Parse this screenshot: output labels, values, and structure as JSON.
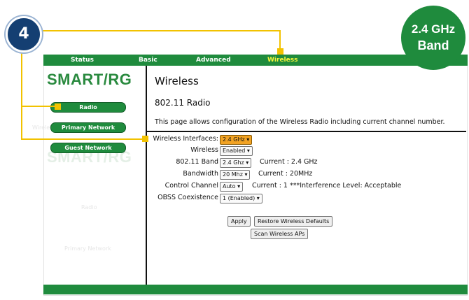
{
  "callout": {
    "step_number": "4",
    "badge_line1": "2.4 GHz",
    "badge_line2": "Band"
  },
  "nav": {
    "items": [
      "Status",
      "Basic",
      "Advanced",
      "Wireless"
    ],
    "active_index": 3
  },
  "brand": {
    "logo_text": "SMART/RG",
    "accent_color": "#1f8b3d",
    "highlight_color": "#f2c200"
  },
  "sidebar": {
    "items": [
      "Radio",
      "Primary Network",
      "Guest Network"
    ]
  },
  "page": {
    "title": "Wireless",
    "section_title": "802.11 Radio",
    "description": "This page allows configuration of the Wireless Radio including current channel number."
  },
  "form": {
    "interfaces": {
      "label": "Wireless Interfaces:",
      "value": "2.4 GHz"
    },
    "wireless": {
      "label": "Wireless",
      "value": "Enabled"
    },
    "band": {
      "label": "802.11 Band",
      "value": "2.4 Ghz",
      "current": "Current :  2.4 GHz"
    },
    "bandwidth": {
      "label": "Bandwidth",
      "value": "20 Mhz",
      "current": "Current :  20MHz"
    },
    "channel": {
      "label": "Control Channel",
      "value": "Auto",
      "current": "Current :  1 ***Interference Level: Acceptable"
    },
    "obss": {
      "label": "OBSS Coexistence",
      "value": "1 (Enabled)"
    }
  },
  "actions": {
    "apply": "Apply",
    "restore": "Restore Wireless Defaults",
    "scan": "Scan Wireless APs"
  },
  "ghost": {
    "side_label_1": "Wireless",
    "side_label_2": "Radio",
    "side_label_3": "Primary Network"
  }
}
